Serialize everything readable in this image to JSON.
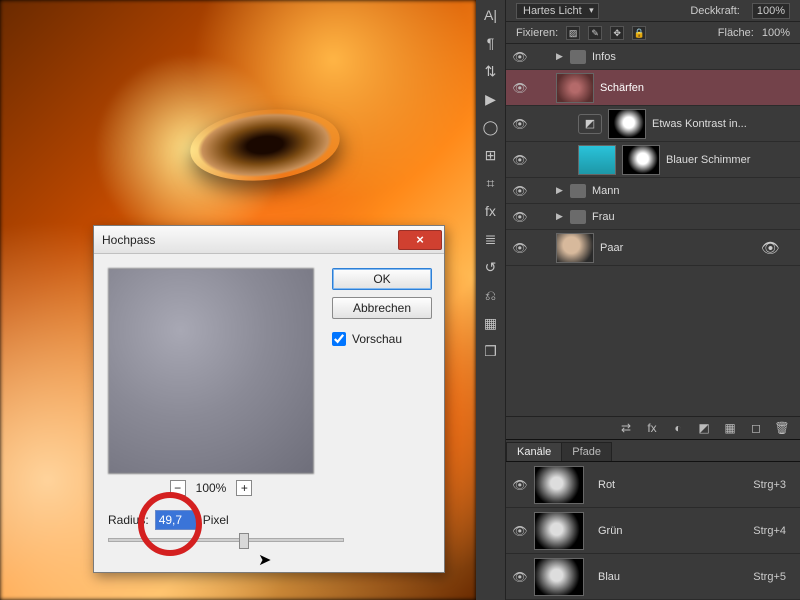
{
  "dialog": {
    "title": "Hochpass",
    "ok": "OK",
    "cancel": "Abbrechen",
    "preview_label": "Vorschau",
    "preview_checked": true,
    "zoom_level": "100%",
    "radius_label": "Radius:",
    "radius_unit": "Pixel",
    "radius_value": "49,7"
  },
  "options_bar": {
    "blend_mode": "Hartes Licht",
    "opacity_label": "Deckkraft:",
    "opacity_value": "100%",
    "lock_label": "Fixieren:",
    "fill_label": "Fläche:",
    "fill_value": "100%"
  },
  "layers": {
    "items": [
      {
        "type": "group",
        "name": "Infos",
        "expanded": false
      },
      {
        "type": "layer",
        "name": "Schärfen",
        "selected": true,
        "thumb": "red"
      },
      {
        "type": "adj",
        "name": "Etwas Kontrast in...",
        "adj_glyph": "◩",
        "mask": true
      },
      {
        "type": "adj",
        "name": "Blauer Schimmer",
        "adj_thumb": "cyan",
        "mask": true
      },
      {
        "type": "group",
        "name": "Mann",
        "expanded": false
      },
      {
        "type": "group",
        "name": "Frau",
        "expanded": false
      },
      {
        "type": "layer",
        "name": "Paar",
        "thumb": "pair",
        "fx": true
      }
    ]
  },
  "channels": {
    "tab_channels": "Kanäle",
    "tab_paths": "Pfade",
    "items": [
      {
        "name": "Rot",
        "shortcut": "Strg+3"
      },
      {
        "name": "Grün",
        "shortcut": "Strg+4"
      },
      {
        "name": "Blau",
        "shortcut": "Strg+5"
      }
    ]
  },
  "side_tool_icons": [
    "A|",
    "¶",
    "⇅",
    "▶",
    "◯",
    "⊞",
    "⌗",
    "fx",
    "≣",
    "↺",
    "⎌",
    "▦",
    "❒"
  ],
  "footer_icons": [
    "⇄",
    "fx",
    "◐",
    "◩",
    "▦",
    "◻",
    "🗑"
  ]
}
